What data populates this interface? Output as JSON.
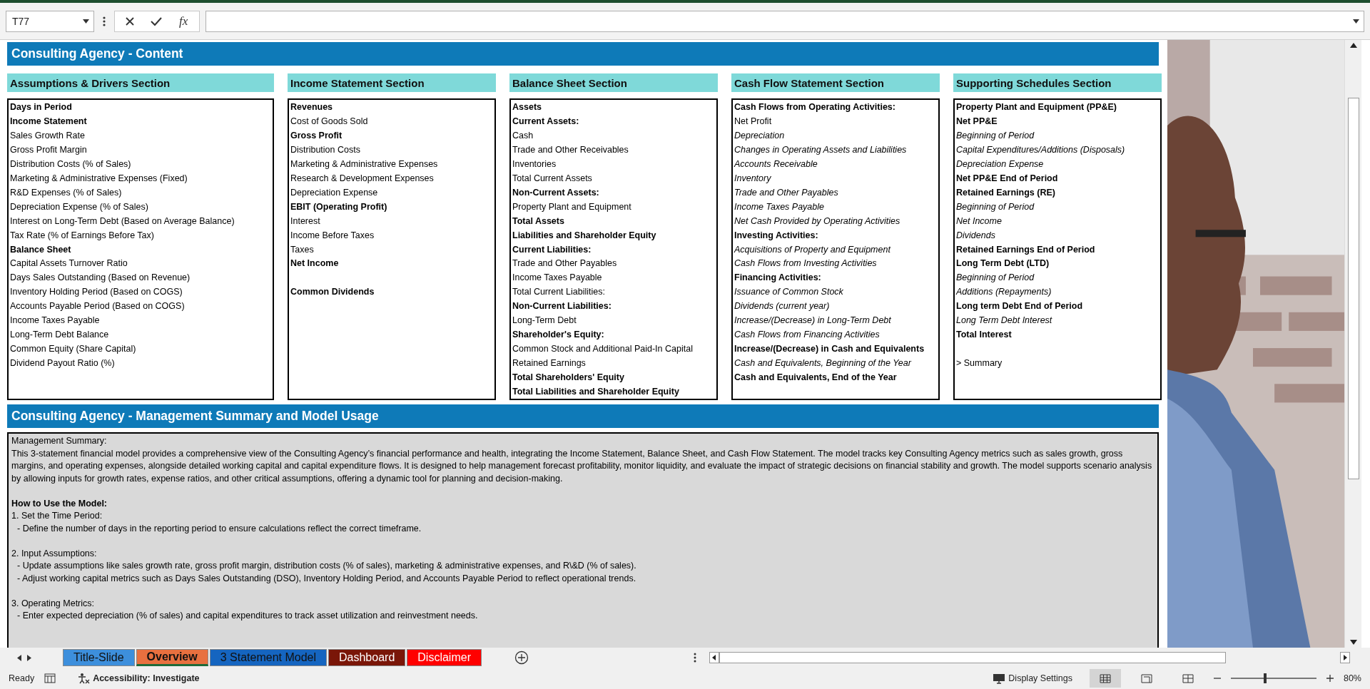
{
  "formula_bar": {
    "name_box": "T77",
    "function_button": "fx"
  },
  "content_header": "Consulting Agency - Content",
  "sections": [
    {
      "title": "Assumptions & Drivers Section",
      "items": [
        {
          "text": "Days in Period",
          "kind": "bold"
        },
        {
          "text": "Income Statement",
          "kind": "bold"
        },
        {
          "text": "Sales Growth Rate",
          "kind": "plain"
        },
        {
          "text": "Gross Profit Margin",
          "kind": "plain"
        },
        {
          "text": "Distribution Costs (% of Sales)",
          "kind": "plain"
        },
        {
          "text": "Marketing & Administrative Expenses (Fixed)",
          "kind": "plain"
        },
        {
          "text": "R&D Expenses (% of Sales)",
          "kind": "plain"
        },
        {
          "text": "Depreciation Expense (% of Sales)",
          "kind": "plain"
        },
        {
          "text": "Interest on Long-Term Debt (Based on Average Balance)",
          "kind": "plain"
        },
        {
          "text": "Tax Rate (% of Earnings Before Tax)",
          "kind": "plain"
        },
        {
          "text": "Balance Sheet",
          "kind": "bold"
        },
        {
          "text": "Capital Assets Turnover Ratio",
          "kind": "plain"
        },
        {
          "text": "Days Sales Outstanding (Based on Revenue)",
          "kind": "plain"
        },
        {
          "text": "Inventory Holding Period (Based on COGS)",
          "kind": "plain"
        },
        {
          "text": "Accounts Payable Period (Based on COGS)",
          "kind": "plain"
        },
        {
          "text": "Income Taxes Payable",
          "kind": "plain"
        },
        {
          "text": "Long-Term Debt Balance",
          "kind": "plain"
        },
        {
          "text": "Common Equity (Share Capital)",
          "kind": "plain"
        },
        {
          "text": "Dividend Payout Ratio (%)",
          "kind": "plain"
        }
      ]
    },
    {
      "title": "Income Statement Section",
      "items": [
        {
          "text": "Revenues",
          "kind": "bold"
        },
        {
          "text": "Cost of Goods Sold",
          "kind": "plain"
        },
        {
          "text": "Gross Profit",
          "kind": "bold"
        },
        {
          "text": "Distribution Costs",
          "kind": "plain"
        },
        {
          "text": "Marketing & Administrative Expenses",
          "kind": "plain"
        },
        {
          "text": "Research & Development Expenses",
          "kind": "plain"
        },
        {
          "text": "Depreciation Expense",
          "kind": "plain"
        },
        {
          "text": "EBIT (Operating Profit)",
          "kind": "bold"
        },
        {
          "text": "Interest",
          "kind": "plain"
        },
        {
          "text": "Income Before Taxes",
          "kind": "plain"
        },
        {
          "text": "Taxes",
          "kind": "plain"
        },
        {
          "text": "Net Income",
          "kind": "bold"
        },
        {
          "text": "Common Dividends",
          "kind": "bold",
          "gap_before": true
        }
      ]
    },
    {
      "title": "Balance Sheet Section",
      "items": [
        {
          "text": "Assets",
          "kind": "bold"
        },
        {
          "text": "Current Assets:",
          "kind": "bold"
        },
        {
          "text": "Cash",
          "kind": "plain"
        },
        {
          "text": "Trade and Other Receivables",
          "kind": "plain"
        },
        {
          "text": "Inventories",
          "kind": "plain"
        },
        {
          "text": "Total Current Assets",
          "kind": "plain"
        },
        {
          "text": "Non-Current Assets:",
          "kind": "bold"
        },
        {
          "text": "Property Plant and Equipment",
          "kind": "plain"
        },
        {
          "text": "Total Assets",
          "kind": "bold"
        },
        {
          "text": "Liabilities and Shareholder Equity",
          "kind": "bold"
        },
        {
          "text": "Current Liabilities:",
          "kind": "bold"
        },
        {
          "text": "Trade and Other Payables",
          "kind": "plain"
        },
        {
          "text": "Income Taxes Payable",
          "kind": "plain"
        },
        {
          "text": "Total Current Liabilities:",
          "kind": "plain"
        },
        {
          "text": "Non-Current Liabilities:",
          "kind": "bold"
        },
        {
          "text": "Long-Term Debt",
          "kind": "plain"
        },
        {
          "text": "Shareholder's Equity:",
          "kind": "bold"
        },
        {
          "text": "Common Stock and Additional Paid-In Capital",
          "kind": "plain"
        },
        {
          "text": "Retained Earnings",
          "kind": "plain"
        },
        {
          "text": "Total Shareholders' Equity",
          "kind": "bold"
        },
        {
          "text": "Total Liabilities and Shareholder Equity",
          "kind": "bold"
        }
      ]
    },
    {
      "title": "Cash Flow Statement Section",
      "items": [
        {
          "text": "Cash Flows from Operating Activities:",
          "kind": "bold"
        },
        {
          "text": "Net Profit",
          "kind": "plain"
        },
        {
          "text": "Depreciation",
          "kind": "italic"
        },
        {
          "text": "Changes in Operating Assets and Liabilities",
          "kind": "italic"
        },
        {
          "text": "Accounts Receivable",
          "kind": "italic"
        },
        {
          "text": "Inventory",
          "kind": "italic"
        },
        {
          "text": "Trade and Other Payables",
          "kind": "italic"
        },
        {
          "text": "Income Taxes Payable",
          "kind": "italic"
        },
        {
          "text": "Net Cash Provided by Operating Activities",
          "kind": "italic"
        },
        {
          "text": "Investing Activities:",
          "kind": "bold"
        },
        {
          "text": "Acquisitions of Property and Equipment",
          "kind": "italic"
        },
        {
          "text": "Cash Flows from Investing Activities",
          "kind": "italic"
        },
        {
          "text": "Financing Activities:",
          "kind": "bold"
        },
        {
          "text": "Issuance of Common Stock",
          "kind": "italic"
        },
        {
          "text": "Dividends (current year)",
          "kind": "italic"
        },
        {
          "text": "Increase/(Decrease) in Long-Term Debt",
          "kind": "italic"
        },
        {
          "text": "Cash Flows from Financing Activities",
          "kind": "italic"
        },
        {
          "text": "Increase/(Decrease) in Cash and Equivalents",
          "kind": "bold"
        },
        {
          "text": "Cash and Equivalents, Beginning of the Year",
          "kind": "italic"
        },
        {
          "text": "Cash and Equivalents, End of the Year",
          "kind": "bold"
        }
      ]
    },
    {
      "title": "Supporting Schedules Section",
      "items": [
        {
          "text": "Property Plant and Equipment (PP&E)",
          "kind": "bold"
        },
        {
          "text": "Net PP&E",
          "kind": "bold"
        },
        {
          "text": "Beginning of Period",
          "kind": "italic"
        },
        {
          "text": "Capital Expenditures/Additions (Disposals)",
          "kind": "italic"
        },
        {
          "text": "Depreciation Expense",
          "kind": "italic"
        },
        {
          "text": "Net PP&E End of Period",
          "kind": "bold"
        },
        {
          "text": "Retained Earnings (RE)",
          "kind": "bold"
        },
        {
          "text": "Beginning of Period",
          "kind": "italic"
        },
        {
          "text": "Net Income",
          "kind": "italic"
        },
        {
          "text": "Dividends",
          "kind": "italic"
        },
        {
          "text": "Retained Earnings End of Period",
          "kind": "bold"
        },
        {
          "text": "Long Term Debt (LTD)",
          "kind": "bold"
        },
        {
          "text": "Beginning of Period",
          "kind": "italic"
        },
        {
          "text": "Additions (Repayments)",
          "kind": "italic"
        },
        {
          "text": "Long term Debt End of Period",
          "kind": "bold"
        },
        {
          "text": "Long Term Debt Interest",
          "kind": "italic"
        },
        {
          "text": "Total Interest",
          "kind": "bold"
        },
        {
          "text": "> Summary",
          "kind": "plain",
          "gap_before": true
        }
      ]
    }
  ],
  "summary_header": "Consulting Agency - Management Summary and Model Usage",
  "summary_lines": [
    {
      "kind": "text",
      "text": "Management Summary:"
    },
    {
      "kind": "text",
      "text": "This 3-statement financial model provides a comprehensive view of the Consulting Agency’s financial performance and health, integrating the Income Statement, Balance Sheet, and Cash Flow Statement. The model tracks key Consulting Agency metrics such as sales growth, gross margins, and operating expenses, alongside detailed working capital and capital expenditure flows. It is designed to help management forecast profitability, monitor liquidity, and evaluate the impact of strategic decisions on financial stability and growth. The model supports scenario analysis by allowing inputs for growth rates, expense ratios, and other critical assumptions, offering a dynamic tool for planning and decision-making."
    },
    {
      "kind": "heading",
      "text": "How to Use the Model:",
      "gap_before": true
    },
    {
      "kind": "text",
      "text": "1. Set the Time Period:"
    },
    {
      "kind": "bullet",
      "text": "- Define the number of days in the reporting period to ensure calculations reflect the correct timeframe."
    },
    {
      "kind": "text",
      "text": "2. Input Assumptions:",
      "gap_before": true
    },
    {
      "kind": "bullet",
      "text": "- Update assumptions like sales growth rate, gross profit margin, distribution costs (% of sales), marketing & administrative expenses, and R\\&D (% of sales)."
    },
    {
      "kind": "bullet",
      "text": "- Adjust working capital metrics such as Days Sales Outstanding (DSO), Inventory Holding Period, and Accounts Payable Period to reflect operational trends."
    },
    {
      "kind": "text",
      "text": "3. Operating Metrics:",
      "gap_before": true
    },
    {
      "kind": "bullet",
      "text": "- Enter expected depreciation (% of sales) and capital expenditures to track asset utilization and reinvestment needs."
    }
  ],
  "sheet_tabs": [
    {
      "label": "Title-Slide",
      "color": "#3d8fdc",
      "selected": false
    },
    {
      "label": "Overview",
      "color": "#e8703f",
      "selected": true
    },
    {
      "label": "3 Statement Model",
      "color": "#1565c0",
      "selected": false
    },
    {
      "label": "Dashboard",
      "color": "#7a1608",
      "selected": false
    },
    {
      "label": "Disclaimer",
      "color": "#ff0000",
      "selected": false
    }
  ],
  "status_bar": {
    "mode": "Ready",
    "accessibility": "Accessibility: Investigate",
    "display_settings": "Display Settings",
    "views": [
      {
        "kind": "normal",
        "selected": true
      },
      {
        "kind": "layout",
        "selected": false
      },
      {
        "kind": "break",
        "selected": false
      }
    ],
    "zoom": {
      "level": 0.4,
      "reading": "80%"
    }
  }
}
